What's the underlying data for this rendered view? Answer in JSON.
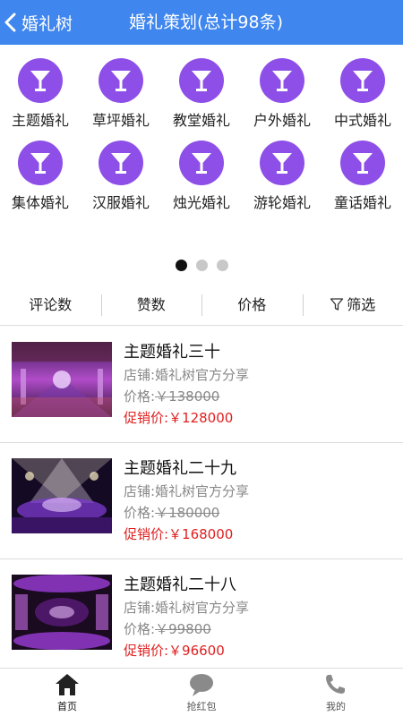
{
  "header": {
    "back_label": "婚礼树",
    "title": "婚礼策划(总计98条)"
  },
  "colors": {
    "header_bg": "#3f86ee",
    "category_icon_bg": "#8e4fe8",
    "promo_price": "#e02020"
  },
  "categories": [
    {
      "label": "主题婚礼",
      "icon": "cocktail-glass-icon"
    },
    {
      "label": "草坪婚礼",
      "icon": "cocktail-glass-icon"
    },
    {
      "label": "教堂婚礼",
      "icon": "cocktail-glass-icon"
    },
    {
      "label": "户外婚礼",
      "icon": "cocktail-glass-icon"
    },
    {
      "label": "中式婚礼",
      "icon": "cocktail-glass-icon"
    },
    {
      "label": "集体婚礼",
      "icon": "cocktail-glass-icon"
    },
    {
      "label": "汉服婚礼",
      "icon": "cocktail-glass-icon"
    },
    {
      "label": "烛光婚礼",
      "icon": "cocktail-glass-icon"
    },
    {
      "label": "游轮婚礼",
      "icon": "cocktail-glass-icon"
    },
    {
      "label": "童话婚礼",
      "icon": "cocktail-glass-icon"
    }
  ],
  "pager": {
    "count": 3,
    "active_index": 0
  },
  "sort": {
    "comments": "评论数",
    "likes": "赞数",
    "price": "价格",
    "filter": "筛选"
  },
  "listings": [
    {
      "name": "主题婚礼三十",
      "shop": "店铺:婚礼树官方分享",
      "price_label": "价格:",
      "price_orig": "￥138000",
      "promo": "促销价:￥128000"
    },
    {
      "name": "主题婚礼二十九",
      "shop": "店铺:婚礼树官方分享",
      "price_label": "价格:",
      "price_orig": "￥180000",
      "promo": "促销价:￥168000"
    },
    {
      "name": "主题婚礼二十八",
      "shop": "店铺:婚礼树官方分享",
      "price_label": "价格:",
      "price_orig": "￥99800",
      "promo": "促销价:￥96600"
    }
  ],
  "tabbar": {
    "home": "首页",
    "red_packet": "抢红包",
    "mine": "我的"
  }
}
